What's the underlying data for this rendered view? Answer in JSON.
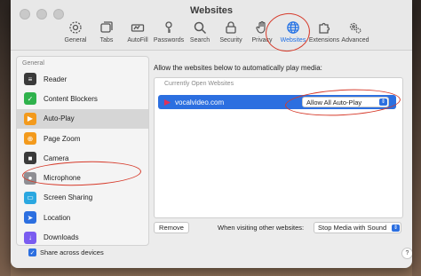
{
  "window": {
    "title": "Websites"
  },
  "toolbar": {
    "tabs": [
      {
        "label": "General",
        "icon": "gear-icon"
      },
      {
        "label": "Tabs",
        "icon": "tabs-icon"
      },
      {
        "label": "AutoFill",
        "icon": "autofill-icon"
      },
      {
        "label": "Passwords",
        "icon": "key-icon"
      },
      {
        "label": "Search",
        "icon": "search-icon"
      },
      {
        "label": "Security",
        "icon": "lock-icon"
      },
      {
        "label": "Privacy",
        "icon": "hand-icon"
      },
      {
        "label": "Websites",
        "icon": "globe-icon",
        "active": true
      },
      {
        "label": "Extensions",
        "icon": "puzzle-icon"
      },
      {
        "label": "Advanced",
        "icon": "gears-icon"
      }
    ]
  },
  "sidebar": {
    "header": "General",
    "items": [
      {
        "label": "Reader",
        "icon": "reader-icon",
        "color": "#3a3a3a"
      },
      {
        "label": "Content Blockers",
        "icon": "shield-check-icon",
        "color": "#2fb24c"
      },
      {
        "label": "Auto-Play",
        "icon": "play-icon",
        "color": "#f39a1c",
        "selected": true
      },
      {
        "label": "Page Zoom",
        "icon": "zoom-icon",
        "color": "#f39a1c"
      },
      {
        "label": "Camera",
        "icon": "camera-icon",
        "color": "#3a3a3a"
      },
      {
        "label": "Microphone",
        "icon": "microphone-icon",
        "color": "#8e8e93"
      },
      {
        "label": "Screen Sharing",
        "icon": "screen-sharing-icon",
        "color": "#2aa7e0"
      },
      {
        "label": "Location",
        "icon": "location-icon",
        "color": "#2c6fe0"
      },
      {
        "label": "Downloads",
        "icon": "downloads-icon",
        "color": "#7a5cf0"
      }
    ]
  },
  "main": {
    "description": "Allow the websites below to automatically play media:",
    "section_header": "Currently Open Websites",
    "sites": [
      {
        "name": "vocalvideo.com",
        "setting": "Allow All Auto-Play"
      }
    ],
    "remove_label": "Remove",
    "other_label": "When visiting other websites:",
    "other_setting": "Stop Media with Sound"
  },
  "footer": {
    "share_label": "Share across devices",
    "share_checked": true,
    "help_label": "?"
  },
  "colors": {
    "accent": "#2c6fe0",
    "annotation": "#d63a2a"
  }
}
